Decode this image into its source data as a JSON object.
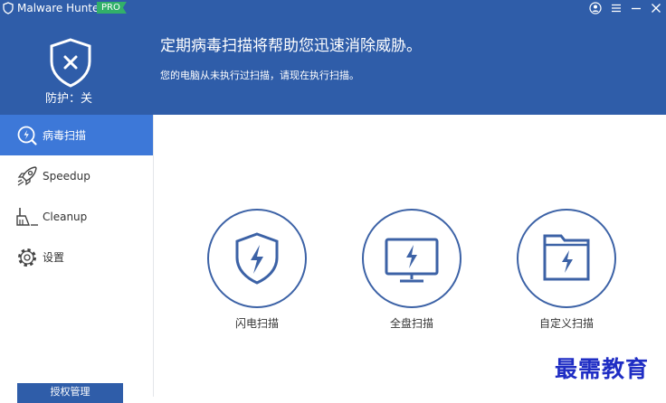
{
  "titlebar": {
    "app_name": "Malware Hunter",
    "badge": "PRO",
    "icons": [
      "account-icon",
      "menu-icon",
      "minimize-icon",
      "close-icon"
    ]
  },
  "status": {
    "protection_label": "防护：关",
    "shield_icon": "shield-x-icon",
    "headline": "定期病毒扫描将帮助您迅速消除威胁。",
    "subline": "您的电脑从未执行过扫描，请现在执行扫描。"
  },
  "sidebar": {
    "items": [
      {
        "label": "病毒扫描",
        "icon": "scan-lightning-icon",
        "active": true
      },
      {
        "label": "Speedup",
        "icon": "rocket-icon",
        "active": false
      },
      {
        "label": "Cleanup",
        "icon": "broom-icon",
        "active": false
      },
      {
        "label": "设置",
        "icon": "gear-icon",
        "active": false
      }
    ],
    "auth_button": "授权管理"
  },
  "scans": [
    {
      "label": "闪电扫描",
      "icon": "shield-lightning-icon"
    },
    {
      "label": "全盘扫描",
      "icon": "monitor-lightning-icon"
    },
    {
      "label": "自定义扫描",
      "icon": "folder-lightning-icon"
    }
  ],
  "watermark": "最需教育",
  "colors": {
    "header_bg": "#2f5da9",
    "active_nav": "#3d78d8",
    "pro_badge": "#32b06a",
    "scan_ring": "#3c62a6",
    "watermark": "#1f2dc4"
  }
}
